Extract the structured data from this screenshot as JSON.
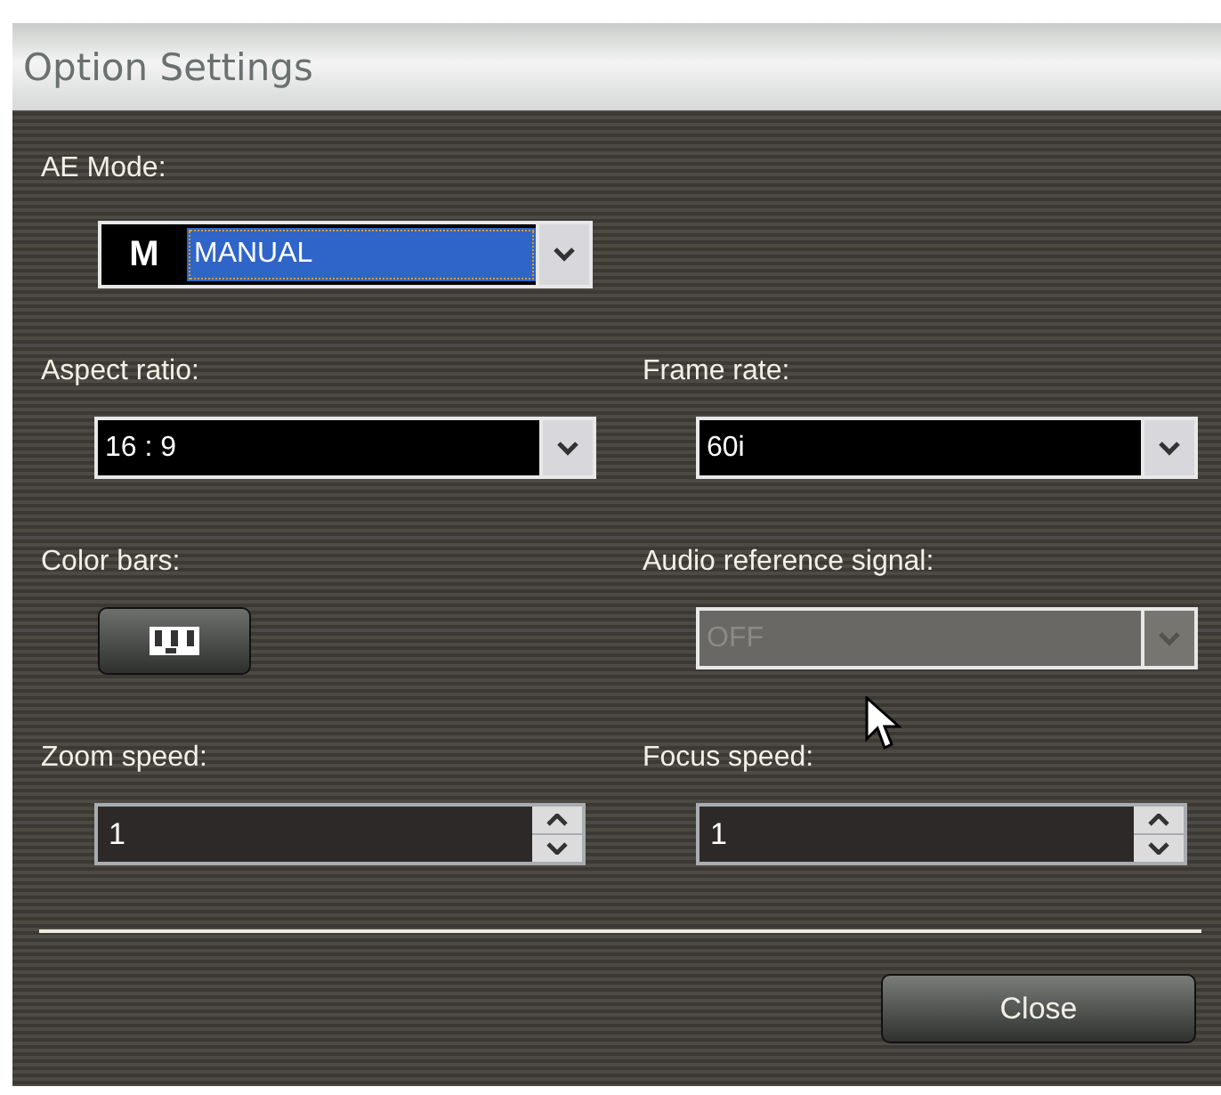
{
  "window": {
    "title": "Option Settings"
  },
  "ae_mode": {
    "label": "AE Mode:",
    "letter": "M",
    "value": "MANUAL",
    "highlighted": true
  },
  "fields": [
    {
      "kind": "combo",
      "label": "Aspect ratio:",
      "value": "16 : 9",
      "disabled": false
    },
    {
      "kind": "combo",
      "label": "Frame rate:",
      "value": "60i",
      "disabled": false
    },
    {
      "kind": "button",
      "label": "Color bars:"
    },
    {
      "kind": "combo",
      "label": "Audio reference signal:",
      "value": "OFF",
      "disabled": true
    },
    {
      "kind": "spinner",
      "label": "Zoom speed:",
      "value": "1"
    },
    {
      "kind": "spinner",
      "label": "Focus speed:",
      "value": "1"
    }
  ],
  "buttons": [
    "Close"
  ]
}
